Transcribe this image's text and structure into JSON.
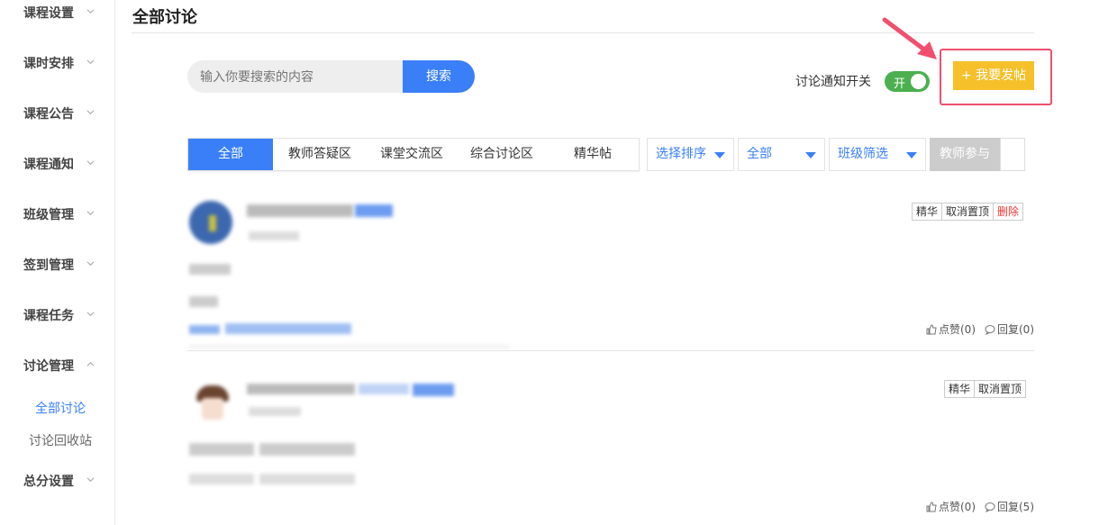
{
  "sidebar": {
    "items": [
      {
        "label": "课程设置"
      },
      {
        "label": "课时安排"
      },
      {
        "label": "课程公告"
      },
      {
        "label": "课程通知"
      },
      {
        "label": "班级管理"
      },
      {
        "label": "签到管理"
      },
      {
        "label": "课程任务"
      },
      {
        "label": "讨论管理"
      },
      {
        "label": "总分设置"
      }
    ],
    "sub_items": [
      {
        "label": "全部讨论",
        "active": true
      },
      {
        "label": "讨论回收站",
        "active": false
      }
    ]
  },
  "header": {
    "title": "全部讨论"
  },
  "search": {
    "placeholder": "输入你要搜索的内容",
    "button": "搜索"
  },
  "notify": {
    "label": "讨论通知开关",
    "toggle_text": "开",
    "state": "on"
  },
  "post_button": {
    "icon": "plus-icon",
    "label": "我要发帖"
  },
  "tabs": [
    {
      "label": "全部",
      "active": true
    },
    {
      "label": "教师答疑区"
    },
    {
      "label": "课堂交流区"
    },
    {
      "label": "综合讨论区"
    },
    {
      "label": "精华帖"
    }
  ],
  "filters": {
    "sort": "选择排序",
    "scope": "全部",
    "class_filter": "班级筛选",
    "teacher_btn": "教师参与"
  },
  "posts": [
    {
      "tags": [
        "精华",
        "取消置顶",
        "删除"
      ],
      "like": "点赞(0)",
      "reply": "回复(0)"
    },
    {
      "tags": [
        "精华",
        "取消置顶"
      ],
      "like": "点赞(0)",
      "reply": "回复(5)"
    }
  ],
  "colors": {
    "accent": "#3a7ff8",
    "post_button": "#f5c02a",
    "toggle_on": "#4caf50",
    "highlight": "#f0506e"
  }
}
